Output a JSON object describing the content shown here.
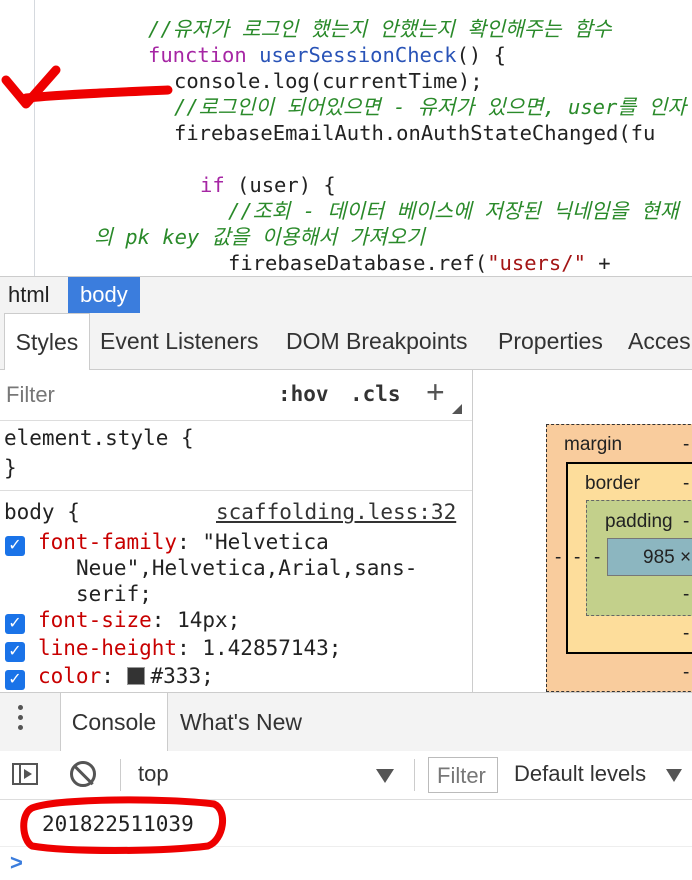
{
  "code": {
    "lines": [
      {
        "comment": "//유저가 로그인 했는지 안했는지 확인해주는 함수"
      },
      {
        "kw": "function ",
        "fn": "userSessionCheck",
        "rest": "() {"
      },
      {
        "text": "console.log(currentTime);"
      },
      {
        "comment": "//로그인이 되어있으면 - 유저가 있으면, user를 인자"
      },
      {
        "text": "firebaseEmailAuth.onAuthStateChanged(fu"
      },
      {
        "kw": "if ",
        "rest": "(user) {"
      },
      {
        "comment": "//조회 - 데이터 베이스에 저장된 닉네임을 현재"
      },
      {
        "comment": "의 pk key 값을 이용해서 가져오기"
      },
      {
        "text": "firebaseDatabase.ref(",
        "str": "\"users/\"",
        "rest": " +"
      }
    ]
  },
  "breadcrumb": {
    "items": [
      "html",
      "body"
    ]
  },
  "panel_tabs": [
    "Styles",
    "Event Listeners",
    "DOM Breakpoints",
    "Properties",
    "Acces"
  ],
  "styles": {
    "filter_placeholder": "Filter",
    "hov": ":hov",
    "cls": ".cls",
    "plus": "+",
    "element_style_open": "element.style {",
    "element_style_close": "}",
    "rule_selector": "body {",
    "rule_source": "scaffolding.less:32",
    "declarations": [
      {
        "prop": "font-family",
        "value": " \"Helvetica"
      },
      {
        "cont1": "Neue\",Helvetica,Arial,sans-"
      },
      {
        "cont2": "serif;"
      },
      {
        "prop": "font-size",
        "value": " 14px;"
      },
      {
        "prop": "line-height",
        "value": " 1.42857143;"
      },
      {
        "prop": "color",
        "value": "#333;"
      }
    ]
  },
  "box_model": {
    "margin_label": "margin",
    "border_label": "border",
    "padding_label": "padding",
    "content_label": "985 ×",
    "dash": "-"
  },
  "drawer": {
    "tabs": [
      "Console",
      "What's New"
    ],
    "context": "top",
    "filter_placeholder": "Filter",
    "levels": "Default levels",
    "log_value": "201822511039",
    "prompt": ">"
  },
  "colors": {
    "accent": "#3b7ddd",
    "annotation": "#ee0000"
  }
}
